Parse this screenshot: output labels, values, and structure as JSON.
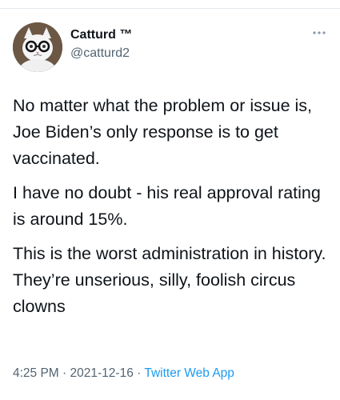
{
  "author": {
    "display_name": "Catturd ™",
    "handle": "@catturd2",
    "avatar_icon": "cat-with-glasses-avatar"
  },
  "menu": {
    "icon": "more-horizontal-icon"
  },
  "tweet": {
    "paragraphs": [
      "No matter what the problem or issue is, Joe Biden’s only response is to get vaccinated.",
      "I have no doubt - his real approval rating is around 15%.",
      "This is the worst administration in history. They’re unserious, silly, foolish circus clowns"
    ]
  },
  "meta": {
    "time": "4:25 PM",
    "separator": "·",
    "date": "2021-12-16",
    "source": "Twitter Web App"
  },
  "colors": {
    "text": "#0f1419",
    "secondary": "#536471",
    "link": "#1d9bf0"
  }
}
